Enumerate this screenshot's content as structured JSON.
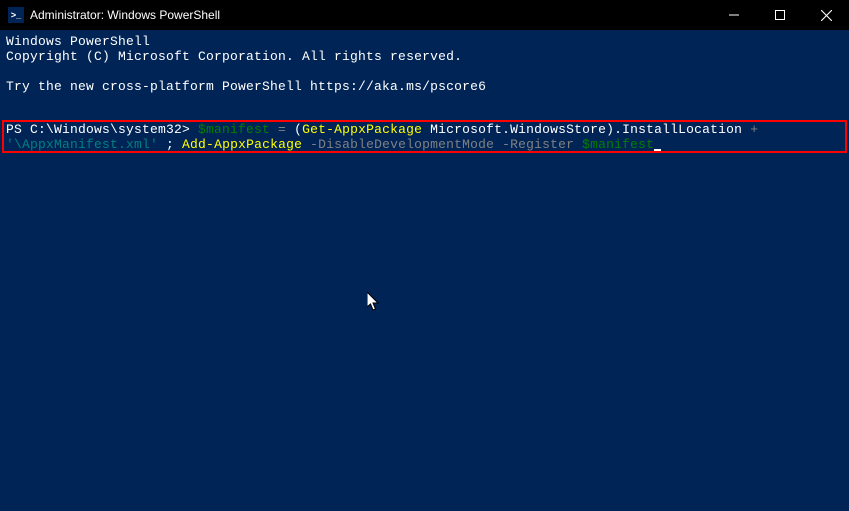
{
  "titlebar": {
    "icon_text": ">_",
    "title": "Administrator: Windows PowerShell"
  },
  "terminal": {
    "header1": "Windows PowerShell",
    "header2": "Copyright (C) Microsoft Corporation. All rights reserved.",
    "header3": "Try the new cross-platform PowerShell https://aka.ms/pscore6",
    "prompt_prefix": "PS C:\\Windows\\system32> ",
    "cmd": {
      "var1": "$manifest",
      "eq": " = ",
      "lparen": "(",
      "cmdlet1": "Get-AppxPackage",
      "arg1": " Microsoft.WindowsStore",
      "rparen": ")",
      "dot_prop": ".InstallLocation ",
      "plus": "+",
      "str1": " '\\AppxManifest.xml' ",
      "semi": "; ",
      "cmdlet2a": "Add-",
      "cmdlet2b": "AppxPackage",
      "param1": " -DisableDevelopmentMode",
      "param2": " -Register ",
      "var2": "$manifest"
    }
  }
}
